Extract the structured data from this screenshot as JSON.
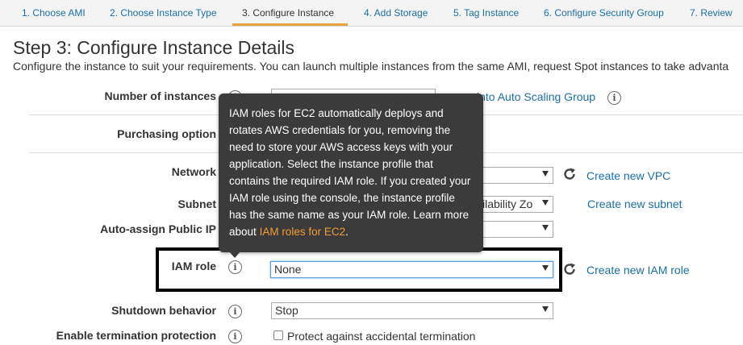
{
  "tabs": [
    {
      "label": "1. Choose AMI"
    },
    {
      "label": "2. Choose Instance Type"
    },
    {
      "label": "3. Configure Instance"
    },
    {
      "label": "4. Add Storage"
    },
    {
      "label": "5. Tag Instance"
    },
    {
      "label": "6. Configure Security Group"
    },
    {
      "label": "7. Review"
    }
  ],
  "header": {
    "title": "Step 3: Configure Instance Details",
    "description": "Configure the instance to suit your requirements. You can launch multiple instances from the same AMI, request Spot instances to take advanta"
  },
  "form": {
    "number_of_instances": {
      "label": "Number of instances",
      "link": "into Auto Scaling Group"
    },
    "purchasing_option": {
      "label": "Purchasing option"
    },
    "network": {
      "label": "Network",
      "link": "Create new VPC"
    },
    "subnet": {
      "label": "Subnet",
      "value": "ilability Zo",
      "link": "Create new subnet"
    },
    "auto_assign_ip": {
      "label": "Auto-assign Public IP"
    },
    "iam_role": {
      "label": "IAM role",
      "value": "None",
      "link": "Create new IAM role"
    },
    "shutdown_behavior": {
      "label": "Shutdown behavior",
      "value": "Stop"
    },
    "termination_protection": {
      "label": "Enable termination protection",
      "checkbox_label": "Protect against accidental termination"
    }
  },
  "tooltip": {
    "text": "IAM roles for EC2 automatically deploys and rotates AWS credentials for you, removing the need to store your AWS access keys with your application. Select the instance profile that contains the required IAM role. If you created your IAM role using the console, the instance profile has the same name as your IAM role. Learn more about",
    "link": "IAM roles for EC2",
    "suffix": "."
  },
  "colors": {
    "link": "#1b6fa8",
    "active_tab_accent": "#e7a33e",
    "tooltip_bg": "#3b3b3b",
    "tooltip_link": "#f39c32"
  }
}
